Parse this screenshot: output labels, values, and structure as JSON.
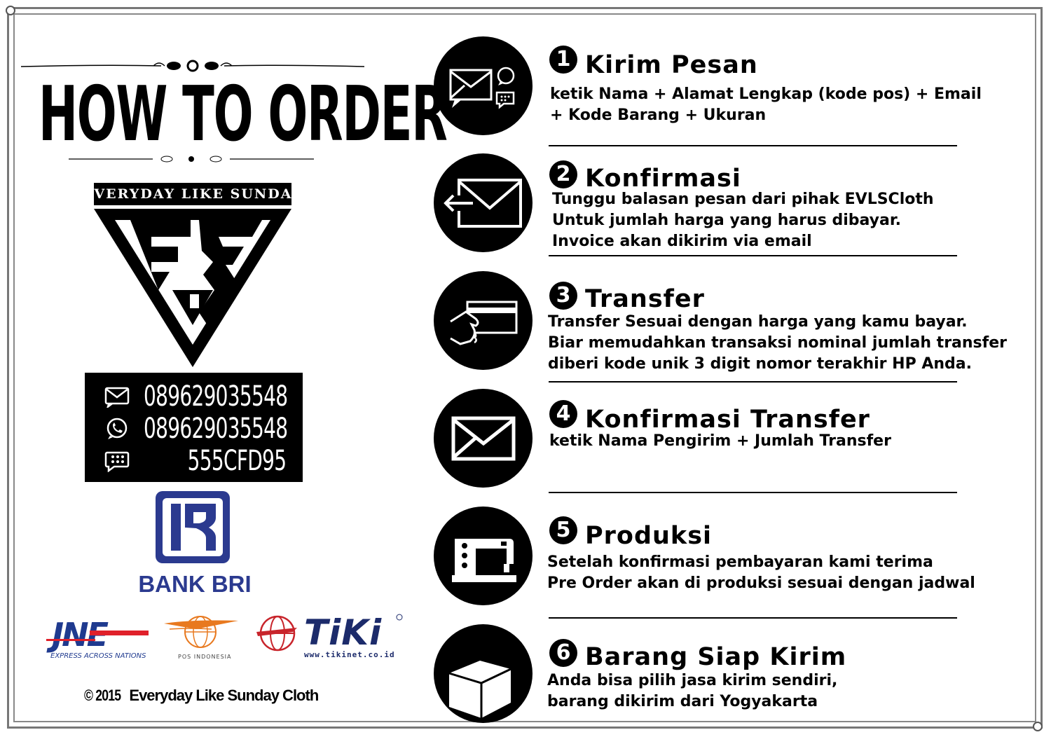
{
  "title": "HOW TO ORDER",
  "brand": {
    "name": "EVERYDAY LIKE SUNDAY",
    "logo_letters": "EVS",
    "logo_inner_letter": "L"
  },
  "contacts": [
    {
      "icon": "sms-icon",
      "value": "089629035548"
    },
    {
      "icon": "whatsapp-icon",
      "value": "089629035548"
    },
    {
      "icon": "bbm-icon",
      "value": "555CFD95"
    }
  ],
  "bank": {
    "name": "BANK BRI"
  },
  "couriers": {
    "jne": {
      "name": "JNE",
      "tagline": "EXPRESS ACROSS NATIONS"
    },
    "pos": {
      "tagline": "POS INDONESIA"
    },
    "tiki": {
      "name": "TIKI",
      "url": "www.tikinet.co.id"
    }
  },
  "copyright": {
    "year": "© 2015",
    "text": "Everyday Like Sunday Cloth"
  },
  "steps": [
    {
      "number": "1",
      "icon": "message-icon",
      "title": "Kirim Pesan",
      "lines": [
        "ketik Nama + Alamat Lengkap (kode pos) + Email",
        "+ Kode Barang + Ukuran"
      ]
    },
    {
      "number": "2",
      "icon": "inbox-envelope-icon",
      "title": "Konfirmasi",
      "lines": [
        "Tunggu balasan pesan dari pihak EVLSCloth",
        "Untuk jumlah harga yang harus dibayar.",
        "Invoice akan dikirim via email"
      ]
    },
    {
      "number": "3",
      "icon": "card-payment-icon",
      "title": "Transfer",
      "lines": [
        "Transfer Sesuai dengan harga yang kamu bayar.",
        "Biar memudahkan transaksi nominal jumlah transfer",
        "diberi kode unik 3 digit nomor terakhir HP Anda."
      ]
    },
    {
      "number": "4",
      "icon": "envelope-icon",
      "title": "Konfirmasi Transfer",
      "lines": [
        "ketik Nama Pengirim + Jumlah Transfer"
      ]
    },
    {
      "number": "5",
      "icon": "sewing-machine-icon",
      "title": "Produksi",
      "lines": [
        "Setelah konfirmasi pembayaran kami terima",
        "Pre Order akan di produksi sesuai dengan jadwal"
      ]
    },
    {
      "number": "6",
      "icon": "box-icon",
      "title": "Barang Siap Kirim",
      "lines": [
        "Anda bisa pilih jasa kirim sendiri,",
        "barang dikirim dari Yogyakarta"
      ]
    }
  ],
  "colors": {
    "bri_blue": "#2b3a8f",
    "jne_red": "#e0202a",
    "jne_blue": "#1f3a8f",
    "tiki_red": "#c8242b",
    "tiki_navy": "#1c2b6b",
    "pos_orange": "#e8791f"
  }
}
